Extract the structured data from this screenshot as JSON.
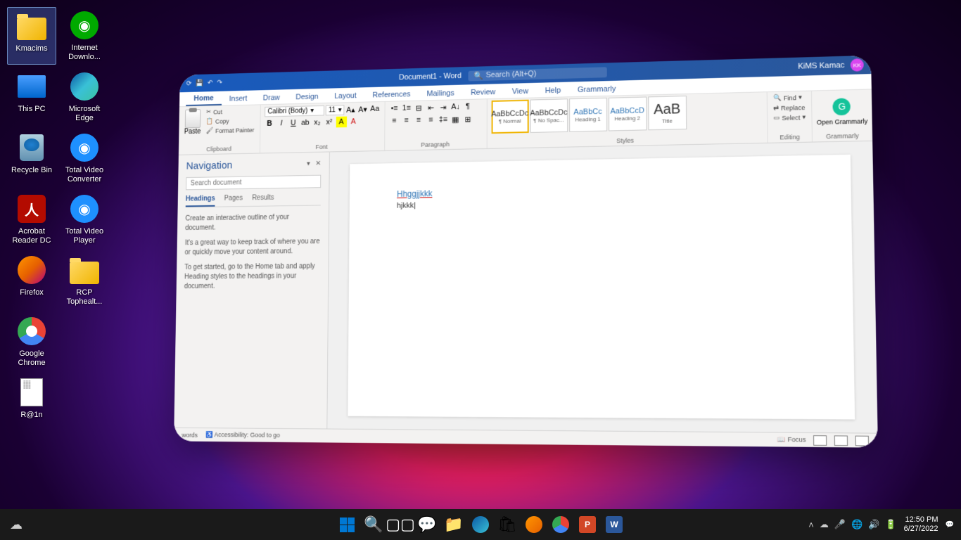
{
  "desktop": {
    "icons": [
      {
        "name": "kmacims-folder",
        "label": "Kmacims",
        "type": "folder",
        "selected": true
      },
      {
        "name": "idm",
        "label": "Internet Downlo...",
        "type": "app",
        "color": "#0a0"
      },
      {
        "name": "this-pc",
        "label": "This PC",
        "type": "pc"
      },
      {
        "name": "edge",
        "label": "Microsoft Edge",
        "type": "edge"
      },
      {
        "name": "recycle-bin",
        "label": "Recycle Bin",
        "type": "bin"
      },
      {
        "name": "total-video-converter",
        "label": "Total Video Converter",
        "type": "app",
        "color": "#1e90ff"
      },
      {
        "name": "acrobat",
        "label": "Acrobat Reader DC",
        "type": "acrobat"
      },
      {
        "name": "total-video-player",
        "label": "Total Video Player",
        "type": "app",
        "color": "#1e90ff"
      },
      {
        "name": "firefox",
        "label": "Firefox",
        "type": "firefox"
      },
      {
        "name": "rcp-folder",
        "label": "RCP Tophealt...",
        "type": "folder"
      },
      {
        "name": "chrome",
        "label": "Google Chrome",
        "type": "chrome"
      },
      {
        "name": "empty",
        "label": "",
        "type": "empty"
      },
      {
        "name": "r-at-1n",
        "label": "R@1n",
        "type": "text"
      }
    ]
  },
  "word": {
    "title": "Document1 - Word",
    "search_placeholder": "Search (Alt+Q)",
    "user_name": "KiMS Kamac",
    "user_initials": "KK",
    "tabs": [
      "Home",
      "Insert",
      "Draw",
      "Design",
      "Layout",
      "References",
      "Mailings",
      "Review",
      "View",
      "Help",
      "Grammarly"
    ],
    "active_tab": "Home",
    "clipboard": {
      "paste": "Paste",
      "cut": "Cut",
      "copy": "Copy",
      "format_painter": "Format Painter",
      "label": "Clipboard"
    },
    "font": {
      "family": "Calibri (Body)",
      "size": "11",
      "label": "Font"
    },
    "paragraph": {
      "label": "Paragraph"
    },
    "styles": {
      "label": "Styles",
      "items": [
        {
          "preview": "AaBbCcDc",
          "name": "¶ Normal",
          "active": true
        },
        {
          "preview": "AaBbCcDc",
          "name": "¶ No Spac..."
        },
        {
          "preview": "AaBbCc",
          "name": "Heading 1",
          "blue": true
        },
        {
          "preview": "AaBbCcD",
          "name": "Heading 2",
          "blue": true
        },
        {
          "preview": "AaB",
          "name": "Title",
          "blue": false,
          "big": true
        }
      ]
    },
    "editing": {
      "find": "Find",
      "replace": "Replace",
      "select": "Select",
      "label": "Editing"
    },
    "grammarly": {
      "open": "Open Grammarly",
      "label": "Grammarly"
    },
    "nav": {
      "title": "Navigation",
      "search_placeholder": "Search document",
      "tabs": [
        "Headings",
        "Pages",
        "Results"
      ],
      "active": "Headings",
      "help1": "Create an interactive outline of your document.",
      "help2": "It's a great way to keep track of where you are or quickly move your content around.",
      "help3": "To get started, go to the Home tab and apply Heading styles to the headings in your document."
    },
    "document": {
      "heading": "Hhggjjkkk",
      "body": "hjkkk|"
    },
    "status": {
      "words": "words",
      "accessibility": "Accessibility: Good to go",
      "focus": "Focus"
    }
  },
  "taskbar": {
    "time": "12:50 PM",
    "date": "6/27/2022"
  }
}
